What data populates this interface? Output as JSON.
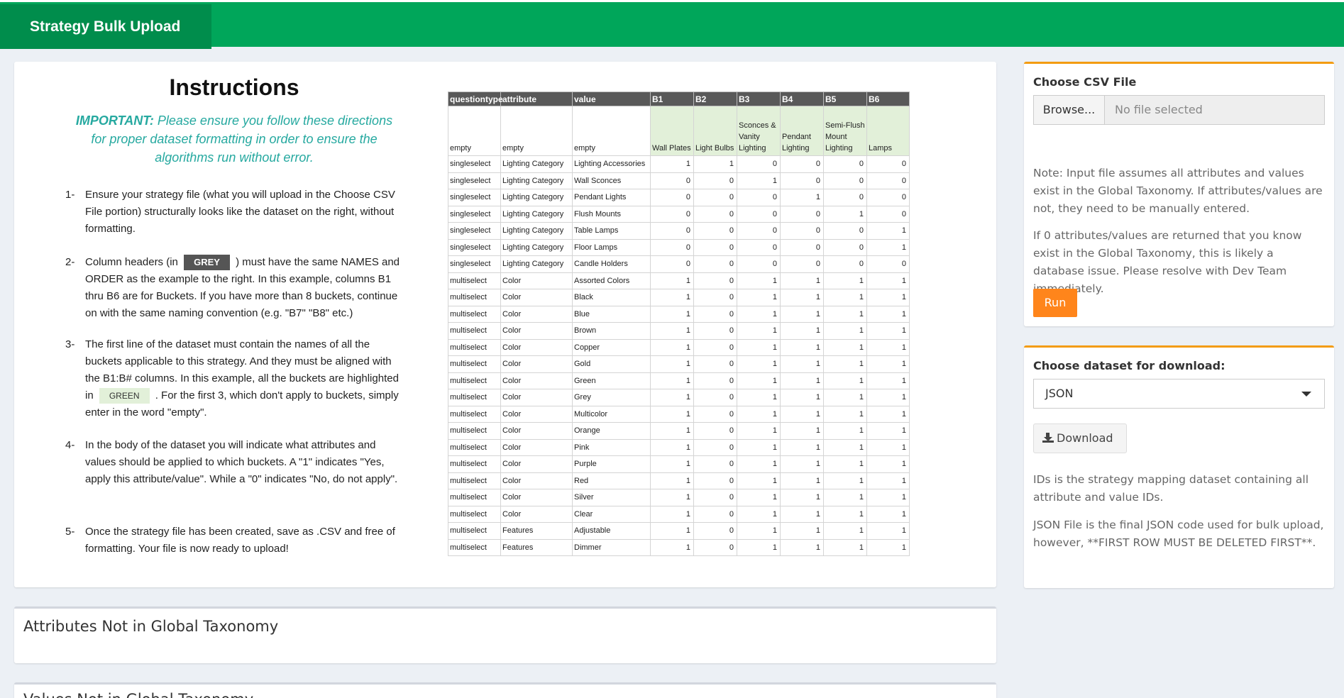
{
  "header": {
    "title": "Strategy Bulk Upload"
  },
  "instructions": {
    "title": "Instructions",
    "important_label": "IMPORTANT:",
    "important_text": " Please ensure you follow these directions for proper dataset formatting in order to ensure the algorithms run without error.",
    "steps": [
      {
        "num": "1-",
        "text": "Ensure your strategy file (what you will upload in the Choose CSV File portion) structurally looks like the dataset on the right, without formatting."
      },
      {
        "num": "2-",
        "pre": "Column headers (in ",
        "chip": "GREY",
        "post": " ) must have the same NAMES and ORDER as the example to the right. In this example, columns B1 thru B6 are for Buckets. If you have more than 8 buckets, continue on with the same naming convention (e.g. \"B7\" \"B8\" etc.)"
      },
      {
        "num": "3-",
        "pre": "The first line of the dataset must contain the names of all the buckets applicable to this strategy. And they must be aligned with the B1:B# columns. In this example, all the buckets are highlighted in ",
        "chip": "GREEN",
        "post": " . For the first 3, which don't apply to buckets, simply enter in the word \"empty\"."
      },
      {
        "num": "4-",
        "text": "In the body of the dataset you will indicate what attributes and values should be applied to which buckets. A \"1\" indicates \"Yes, apply this attribute/value\". While a \"0\" indicates \"No, do not apply\"."
      },
      {
        "num": "5-",
        "text": "Once the strategy file has been created, save as .CSV and free of formatting. Your file is now ready to upload!"
      }
    ],
    "table": {
      "headers": [
        "questiontype",
        "attribute",
        "value",
        "B1",
        "B2",
        "B3",
        "B4",
        "B5",
        "B6"
      ],
      "bucket_row": [
        "empty",
        "empty",
        "empty",
        "Wall Plates",
        "Light Bulbs",
        "Sconces & Vanity Lighting",
        "Pendant Lighting",
        "Semi-Flush Mount Lighting",
        "Lamps"
      ],
      "rows": [
        [
          "singleselect",
          "Lighting Category",
          "Lighting Accessories",
          "1",
          "1",
          "0",
          "0",
          "0",
          "0"
        ],
        [
          "singleselect",
          "Lighting Category",
          "Wall Sconces",
          "0",
          "0",
          "1",
          "0",
          "0",
          "0"
        ],
        [
          "singleselect",
          "Lighting Category",
          "Pendant Lights",
          "0",
          "0",
          "0",
          "1",
          "0",
          "0"
        ],
        [
          "singleselect",
          "Lighting Category",
          "Flush Mounts",
          "0",
          "0",
          "0",
          "0",
          "1",
          "0"
        ],
        [
          "singleselect",
          "Lighting Category",
          "Table Lamps",
          "0",
          "0",
          "0",
          "0",
          "0",
          "1"
        ],
        [
          "singleselect",
          "Lighting Category",
          "Floor Lamps",
          "0",
          "0",
          "0",
          "0",
          "0",
          "1"
        ],
        [
          "singleselect",
          "Lighting Category",
          "Candle Holders",
          "0",
          "0",
          "0",
          "0",
          "0",
          "0"
        ],
        [
          "multiselect",
          "Color",
          "Assorted Colors",
          "1",
          "0",
          "1",
          "1",
          "1",
          "1"
        ],
        [
          "multiselect",
          "Color",
          "Black",
          "1",
          "0",
          "1",
          "1",
          "1",
          "1"
        ],
        [
          "multiselect",
          "Color",
          "Blue",
          "1",
          "0",
          "1",
          "1",
          "1",
          "1"
        ],
        [
          "multiselect",
          "Color",
          "Brown",
          "1",
          "0",
          "1",
          "1",
          "1",
          "1"
        ],
        [
          "multiselect",
          "Color",
          "Copper",
          "1",
          "0",
          "1",
          "1",
          "1",
          "1"
        ],
        [
          "multiselect",
          "Color",
          "Gold",
          "1",
          "0",
          "1",
          "1",
          "1",
          "1"
        ],
        [
          "multiselect",
          "Color",
          "Green",
          "1",
          "0",
          "1",
          "1",
          "1",
          "1"
        ],
        [
          "multiselect",
          "Color",
          "Grey",
          "1",
          "0",
          "1",
          "1",
          "1",
          "1"
        ],
        [
          "multiselect",
          "Color",
          "Multicolor",
          "1",
          "0",
          "1",
          "1",
          "1",
          "1"
        ],
        [
          "multiselect",
          "Color",
          "Orange",
          "1",
          "0",
          "1",
          "1",
          "1",
          "1"
        ],
        [
          "multiselect",
          "Color",
          "Pink",
          "1",
          "0",
          "1",
          "1",
          "1",
          "1"
        ],
        [
          "multiselect",
          "Color",
          "Purple",
          "1",
          "0",
          "1",
          "1",
          "1",
          "1"
        ],
        [
          "multiselect",
          "Color",
          "Red",
          "1",
          "0",
          "1",
          "1",
          "1",
          "1"
        ],
        [
          "multiselect",
          "Color",
          "Silver",
          "1",
          "0",
          "1",
          "1",
          "1",
          "1"
        ],
        [
          "multiselect",
          "Color",
          "Clear",
          "1",
          "0",
          "1",
          "1",
          "1",
          "1"
        ],
        [
          "multiselect",
          "Features",
          "Adjustable",
          "1",
          "0",
          "1",
          "1",
          "1",
          "1"
        ],
        [
          "multiselect",
          "Features",
          "Dimmer",
          "1",
          "0",
          "1",
          "1",
          "1",
          "1"
        ]
      ]
    }
  },
  "csv_box": {
    "label": "Choose CSV File",
    "browse_label": "Browse...",
    "file_placeholder": "No file selected",
    "note1": "Note: Input file assumes all attributes and values exist in the Global Taxonomy. If attributes/values are not, they need to be manually entered.",
    "note2": "If 0 attributes/values are returned that you know exist in the Global Taxonomy, this is likely a database issue. Please resolve with Dev Team immediately.",
    "run_label": "Run"
  },
  "download_box": {
    "label": "Choose dataset for download:",
    "selected": "JSON",
    "download_label": "Download",
    "note1": "IDs is the strategy mapping dataset containing all attribute and value IDs.",
    "note2": "JSON File is the final JSON code used for bulk upload, however, **FIRST ROW MUST BE DELETED FIRST**."
  },
  "sections": {
    "attributes_title": "Attributes Not in Global Taxonomy",
    "values_title": "Values Not in Global Taxonomy"
  },
  "colors": {
    "header": "#00a65a",
    "brand": "#008d4c",
    "run": "#ff851b",
    "accent_border": "#f39c12",
    "table_header": "#595959",
    "bucket_green": "#e2f0d9"
  }
}
